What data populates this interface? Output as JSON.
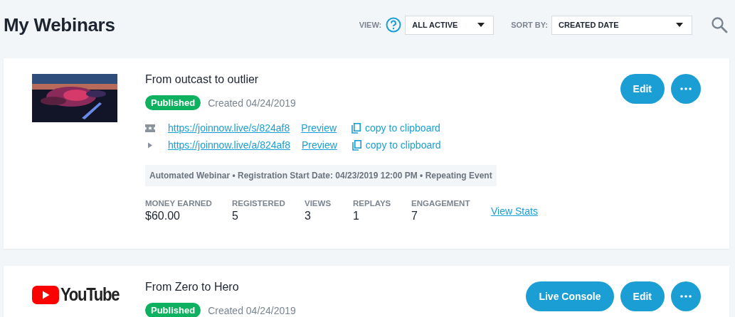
{
  "header": {
    "title": "My Webinars",
    "view_label": "VIEW:",
    "view_value": "ALL ACTIVE",
    "sort_label": "SORT BY:",
    "sort_value": "CREATED DATE"
  },
  "webinars": [
    {
      "thumbnail": {
        "kind": "picture"
      },
      "title": "From outcast to outlier",
      "status": "Published",
      "created": "Created 04/24/2019",
      "buttons": [
        {
          "kind": "edit",
          "label": "Edit"
        },
        {
          "kind": "more"
        }
      ],
      "links": [
        {
          "kind": "registration",
          "url": "https://joinnow.live/s/824af8",
          "preview": "Preview",
          "copy": "copy to clipboard"
        },
        {
          "kind": "replay",
          "url": "https://joinnow.live/a/824af8",
          "preview": "Preview",
          "copy": "copy to clipboard"
        }
      ],
      "info": "Automated Webinar • Registration Start Date: 04/23/2019 12:00 PM • Repeating Event",
      "stats": [
        {
          "label": "MONEY EARNED",
          "value": "$60.00"
        },
        {
          "label": "REGISTERED",
          "value": "5"
        },
        {
          "label": "VIEWS",
          "value": "3"
        },
        {
          "label": "REPLAYS",
          "value": "1"
        },
        {
          "label": "ENGAGEMENT",
          "value": "7"
        }
      ],
      "stats_link": "View Stats"
    },
    {
      "thumbnail": {
        "kind": "youtube",
        "logo_text": "YouTube"
      },
      "title": "From Zero to Hero",
      "status": "Published",
      "created": "Created 04/24/2019",
      "buttons": [
        {
          "kind": "console",
          "label": "Live Console"
        },
        {
          "kind": "edit",
          "label": "Edit"
        },
        {
          "kind": "more"
        }
      ]
    }
  ]
}
